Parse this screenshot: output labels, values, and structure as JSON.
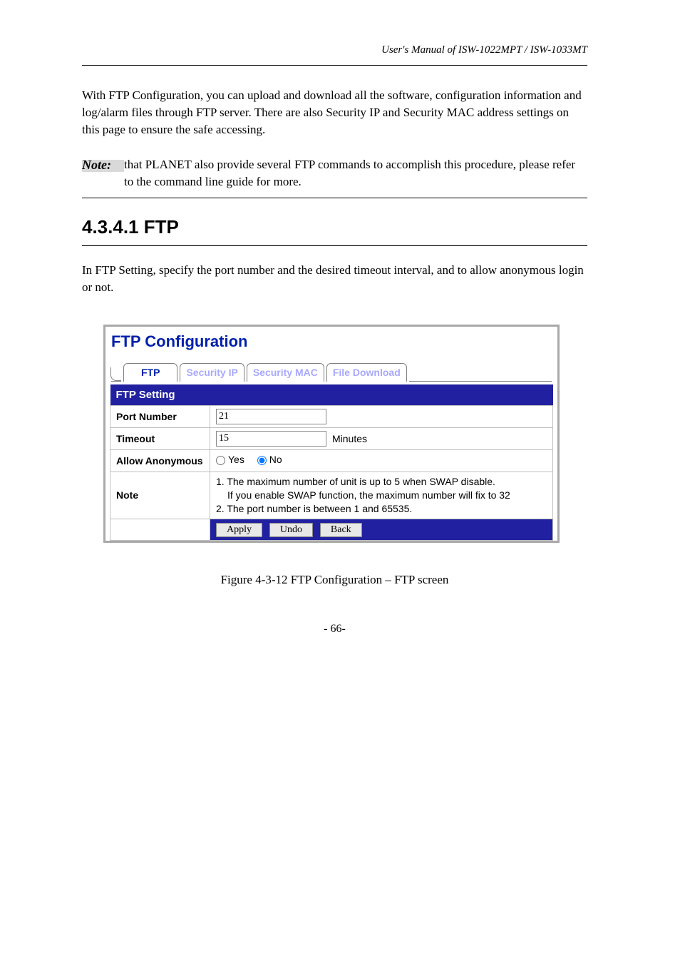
{
  "header": {
    "doc_title": "User's Manual of ISW-1022MPT / ISW-1033MT"
  },
  "intro": {
    "p1": "With FTP Configuration, you can upload and download all the software, configuration information and log/alarm files through FTP server. There are also Security IP and Security MAC address settings on this page to ensure the safe accessing.",
    "note_label": "Note:",
    "note_text": "that PLANET also provide several FTP commands to accomplish this procedure, please refer to the command line guide for more."
  },
  "heading": "4.3.4.1 FTP",
  "subtext": "In FTP Setting, specify the port number and the desired timeout interval, and to allow anonymous login or not.",
  "shot": {
    "title": "FTP Configuration",
    "tabs": {
      "active": "FTP",
      "t1": "Security IP",
      "t2": "Security MAC",
      "t3": "File Download"
    },
    "section_header": "FTP Setting",
    "rows": {
      "port_label": "Port Number",
      "port_value": "21",
      "timeout_label": "Timeout",
      "timeout_value": "15",
      "timeout_unit": "Minutes",
      "anon_label": "Allow Anonymous",
      "anon_yes": "Yes",
      "anon_no": "No",
      "note_label": "Note",
      "note_line1": "1. The maximum number of unit is up to 5 when SWAP disable.",
      "note_line1b": "If you enable SWAP function, the maximum number will fix to 32",
      "note_line2": "2. The port number is between 1 and 65535."
    },
    "buttons": {
      "apply": "Apply",
      "undo": "Undo",
      "back": "Back"
    }
  },
  "caption": "Figure 4-3-12 FTP Configuration – FTP screen",
  "pagenum": "- 66-"
}
